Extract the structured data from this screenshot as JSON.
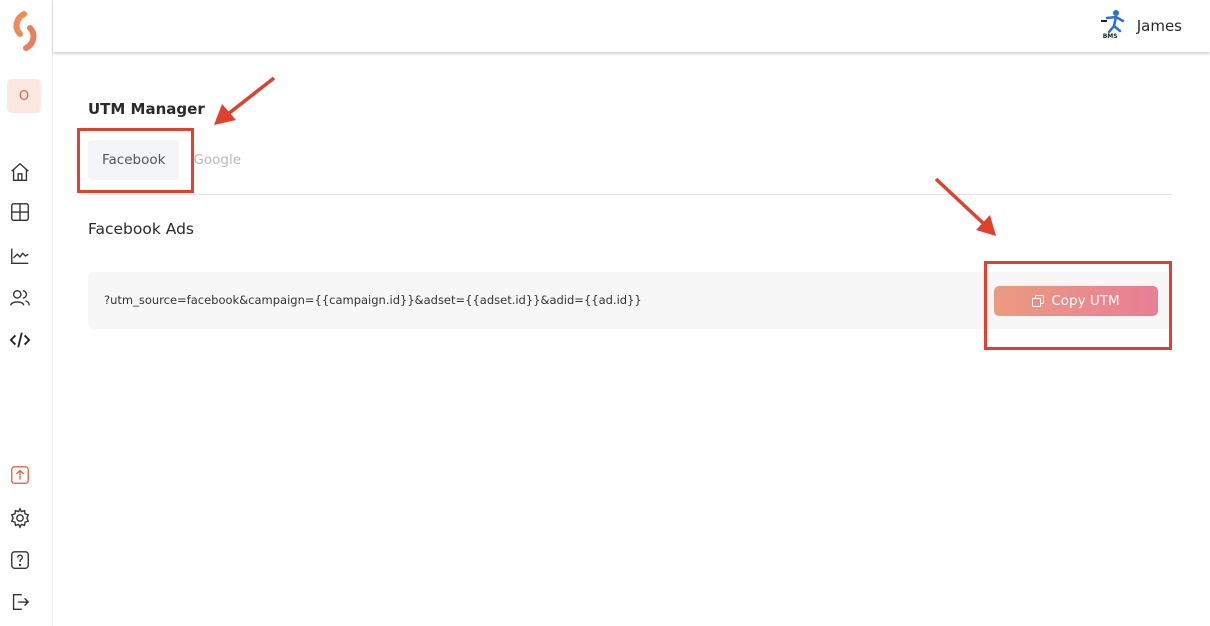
{
  "header": {
    "user_name": "James",
    "user_logo_text": "BMS"
  },
  "sidebar": {
    "org_initial": "O",
    "items": [
      {
        "icon": "home-icon"
      },
      {
        "icon": "dashboard-icon"
      },
      {
        "icon": "chart-icon"
      },
      {
        "icon": "users-icon"
      },
      {
        "icon": "code-icon"
      },
      {
        "icon": "upload-icon"
      },
      {
        "icon": "gear-icon"
      },
      {
        "icon": "help-icon"
      },
      {
        "icon": "logout-icon"
      }
    ]
  },
  "main": {
    "title": "UTM Manager",
    "tabs": [
      {
        "label": "Facebook",
        "active": true
      },
      {
        "label": "Google",
        "active": false
      }
    ],
    "section_title": "Facebook Ads",
    "utm_string": "?utm_source=facebook&campaign={{campaign.id}}&adset={{adset.id}}&adid={{ad.id}}",
    "copy_button_label": "Copy UTM"
  },
  "colors": {
    "accent": "#e87f96",
    "brand_orange": "#ef8a5a",
    "annotation_red": "#e0412c"
  }
}
